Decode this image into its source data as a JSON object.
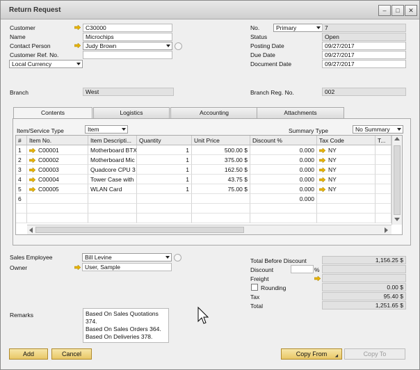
{
  "window": {
    "title": "Return Request"
  },
  "header_left": {
    "customer_label": "Customer",
    "customer_value": "C30000",
    "name_label": "Name",
    "name_value": "Microchips",
    "contact_label": "Contact Person",
    "contact_value": "Judy Brown",
    "ref_label": "Customer Ref. No.",
    "ref_value": "",
    "currency_value": "Local Currency",
    "branch_label": "Branch",
    "branch_value": "West"
  },
  "header_right": {
    "no_label": "No.",
    "series_value": "Primary",
    "no_value": "7",
    "status_label": "Status",
    "status_value": "Open",
    "posting_label": "Posting Date",
    "posting_value": "09/27/2017",
    "due_label": "Due Date",
    "due_value": "09/27/2017",
    "doc_label": "Document Date",
    "doc_value": "09/27/2017",
    "branch_reg_label": "Branch Reg. No.",
    "branch_reg_value": "002"
  },
  "tabs": [
    "Contents",
    "Logistics",
    "Accounting",
    "Attachments"
  ],
  "contents": {
    "type_label": "Item/Service Type",
    "type_value": "Item",
    "summary_label": "Summary Type",
    "summary_value": "No Summary"
  },
  "table": {
    "columns": [
      "#",
      "Item No.",
      "Item Descripti...",
      "Quantity",
      "Unit Price",
      "Discount %",
      "Tax Code",
      "T..."
    ],
    "rows": [
      {
        "num": "1",
        "item": "C00001",
        "desc": "Motherboard BTX",
        "qty": "1",
        "price": "500.00 $",
        "disc": "0.000",
        "tax": "NY"
      },
      {
        "num": "2",
        "item": "C00002",
        "desc": "Motherboard Mic",
        "qty": "1",
        "price": "375.00 $",
        "disc": "0.000",
        "tax": "NY"
      },
      {
        "num": "3",
        "item": "C00003",
        "desc": "Quadcore CPU 3",
        "qty": "1",
        "price": "162.50 $",
        "disc": "0.000",
        "tax": "NY"
      },
      {
        "num": "4",
        "item": "C00004",
        "desc": "Tower Case with",
        "qty": "1",
        "price": "43.75 $",
        "disc": "0.000",
        "tax": "NY"
      },
      {
        "num": "5",
        "item": "C00005",
        "desc": "WLAN Card",
        "qty": "1",
        "price": "75.00 $",
        "disc": "0.000",
        "tax": "NY"
      },
      {
        "num": "6",
        "item": "",
        "desc": "",
        "qty": "",
        "price": "",
        "disc": "0.000",
        "tax": ""
      }
    ]
  },
  "footer_left": {
    "sales_emp_label": "Sales Employee",
    "sales_emp_value": "Bill Levine",
    "owner_label": "Owner",
    "owner_value": "User, Sample",
    "remarks_label": "Remarks",
    "remarks_lines": [
      "Based On Sales Quotations 374.",
      "Based On Sales Orders 364.",
      "Based On Deliveries 378."
    ]
  },
  "totals": {
    "tbd_label": "Total Before Discount",
    "tbd_value": "1,156.25 $",
    "discount_label": "Discount",
    "pct_symbol": "%",
    "freight_label": "Freight",
    "rounding_label": "Rounding",
    "rounding_value": "0.00 $",
    "tax_label": "Tax",
    "tax_value": "95.40 $",
    "total_label": "Total",
    "total_value": "1,251.65 $"
  },
  "buttons": {
    "add": "Add",
    "cancel": "Cancel",
    "copy_from": "Copy From",
    "copy_to": "Copy To"
  },
  "colors": {
    "link_arrow": "#e8b400",
    "button_yellow": "#e8c766"
  }
}
